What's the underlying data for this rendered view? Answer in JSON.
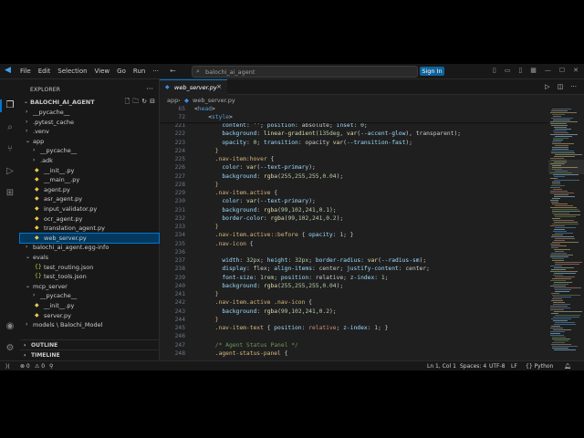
{
  "titlebar": {
    "menu": [
      "File",
      "Edit",
      "Selection",
      "View",
      "Go",
      "Run"
    ],
    "more": "···",
    "back": "←",
    "forward": "→",
    "search": "balochi_ai_agent",
    "signin": "Sign In"
  },
  "sidebar": {
    "title": "EXPLORER",
    "more": "···",
    "project": "BALOCHI_AI_AGENT",
    "tree": [
      {
        "name": "__pycache__",
        "indent": 1,
        "kind": "folder",
        "open": false
      },
      {
        "name": ".pytest_cache",
        "indent": 1,
        "kind": "folder",
        "open": false
      },
      {
        "name": ".venv",
        "indent": 1,
        "kind": "folder",
        "open": false
      },
      {
        "name": "app",
        "indent": 1,
        "kind": "folder",
        "open": true
      },
      {
        "name": "__pycache__",
        "indent": 2,
        "kind": "folder",
        "open": false
      },
      {
        "name": ".adk",
        "indent": 2,
        "kind": "folder",
        "open": false
      },
      {
        "name": "__init__.py",
        "indent": 2,
        "kind": "py"
      },
      {
        "name": "__main__.py",
        "indent": 2,
        "kind": "py"
      },
      {
        "name": "agent.py",
        "indent": 2,
        "kind": "py"
      },
      {
        "name": "asr_agent.py",
        "indent": 2,
        "kind": "py"
      },
      {
        "name": "input_validator.py",
        "indent": 2,
        "kind": "py"
      },
      {
        "name": "ocr_agent.py",
        "indent": 2,
        "kind": "py"
      },
      {
        "name": "translation_agent.py",
        "indent": 2,
        "kind": "py"
      },
      {
        "name": "web_server.py",
        "indent": 2,
        "kind": "py",
        "selected": true
      },
      {
        "name": "balochi_ai_agent.egg-info",
        "indent": 1,
        "kind": "folder",
        "open": false
      },
      {
        "name": "evals",
        "indent": 1,
        "kind": "folder",
        "open": true
      },
      {
        "name": "test_routing.json",
        "indent": 2,
        "kind": "json"
      },
      {
        "name": "test_tools.json",
        "indent": 2,
        "kind": "json"
      },
      {
        "name": "mcp_server",
        "indent": 1,
        "kind": "folder",
        "open": true
      },
      {
        "name": "__pycache__",
        "indent": 2,
        "kind": "folder",
        "open": false
      },
      {
        "name": "__init__.py",
        "indent": 2,
        "kind": "py"
      },
      {
        "name": "server.py",
        "indent": 2,
        "kind": "py"
      },
      {
        "name": "models \\ Balochi_Model",
        "indent": 1,
        "kind": "folder",
        "open": false
      }
    ],
    "outline": "OUTLINE",
    "timeline": "TIMELINE"
  },
  "editor": {
    "tab": {
      "label": "web_server.py",
      "icon": "python-icon"
    },
    "breadcrumb": [
      "app",
      "web_server.py"
    ],
    "sticky": [
      {
        "n": "65",
        "html": "<span class=\"tk-pun\">&lt;</span><span class=\"tk-tag\">head</span><span class=\"tk-pun\">&gt;</span>",
        "indent": 0
      },
      {
        "n": "72",
        "html": "<span class=\"tk-pun\">&lt;</span><span class=\"tk-tag\">style</span><span class=\"tk-pun\">&gt;</span>",
        "indent": 4
      }
    ],
    "lines": [
      {
        "n": "221",
        "indent": 8,
        "text": "content: ''; position: absolute; inset: 0;"
      },
      {
        "n": "222",
        "indent": 8,
        "text": "background: linear-gradient(135deg, var(--accent-glow), transparent);"
      },
      {
        "n": "223",
        "indent": 8,
        "text": "opacity: 0; transition: opacity var(--transition-fast);"
      },
      {
        "n": "224",
        "indent": 6,
        "text": "}"
      },
      {
        "n": "225",
        "indent": 6,
        "text": ".nav-item:hover {"
      },
      {
        "n": "226",
        "indent": 8,
        "text": "color: var(--text-primary);"
      },
      {
        "n": "227",
        "indent": 8,
        "text": "background: rgba(255,255,255,0.04);"
      },
      {
        "n": "228",
        "indent": 6,
        "text": "}"
      },
      {
        "n": "229",
        "indent": 6,
        "text": ".nav-item.active {"
      },
      {
        "n": "230",
        "indent": 8,
        "text": "color: var(--text-primary);"
      },
      {
        "n": "231",
        "indent": 8,
        "text": "background: rgba(99,102,241,0.1);"
      },
      {
        "n": "232",
        "indent": 8,
        "text": "border-color: rgba(99,102,241,0.2);"
      },
      {
        "n": "233",
        "indent": 6,
        "text": "}"
      },
      {
        "n": "234",
        "indent": 6,
        "text": ".nav-item.active::before { opacity: 1; }"
      },
      {
        "n": "235",
        "indent": 6,
        "text": ".nav-icon {"
      },
      {
        "n": "236",
        "indent": 8,
        "text": ""
      },
      {
        "n": "237",
        "indent": 8,
        "text": "width: 32px; height: 32px; border-radius: var(--radius-sm);"
      },
      {
        "n": "238",
        "indent": 8,
        "text": "display: flex; align-items: center; justify-content: center;"
      },
      {
        "n": "239",
        "indent": 8,
        "text": "font-size: 1rem; position: relative; z-index: 1;"
      },
      {
        "n": "240",
        "indent": 8,
        "text": "background: rgba(255,255,255,0.04);"
      },
      {
        "n": "241",
        "indent": 6,
        "text": "}"
      },
      {
        "n": "242",
        "indent": 6,
        "text": ".nav-item.active .nav-icon {"
      },
      {
        "n": "243",
        "indent": 8,
        "text": "background: rgba(99,102,241,0.2);"
      },
      {
        "n": "244",
        "indent": 6,
        "text": "}"
      },
      {
        "n": "245",
        "indent": 6,
        "text": ".nav-item-text { position: relative; z-index: 1; }"
      },
      {
        "n": "246",
        "indent": 6,
        "text": ""
      },
      {
        "n": "247",
        "indent": 6,
        "text": "/* Agent Status Panel */"
      },
      {
        "n": "248",
        "indent": 6,
        "text": ".agent-status-panel {"
      }
    ]
  },
  "statusbar": {
    "errors": "⊗ 0",
    "warnings": "⚠ 0",
    "position": "Ln 1, Col 1",
    "spaces": "Spaces: 4",
    "encoding": "UTF-8",
    "eol": "LF",
    "language": "{} Python"
  }
}
